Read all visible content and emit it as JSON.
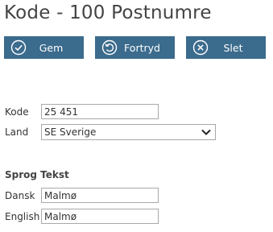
{
  "page": {
    "title": "Kode - 100 Postnumre"
  },
  "toolbar": {
    "save_label": "Gem",
    "undo_label": "Fortryd",
    "delete_label": "Slet"
  },
  "form": {
    "code_label": "Kode",
    "code_value": "25 451",
    "country_label": "Land",
    "country_value": "SE Sverige"
  },
  "translations": {
    "header_language": "Sprog",
    "header_text": "Tekst",
    "rows": [
      {
        "language": "Dansk",
        "text": "Malmø"
      },
      {
        "language": "English",
        "text": "Malmø"
      }
    ]
  },
  "colors": {
    "button_bg": "#3b6b8d",
    "button_text": "#ffffff"
  }
}
